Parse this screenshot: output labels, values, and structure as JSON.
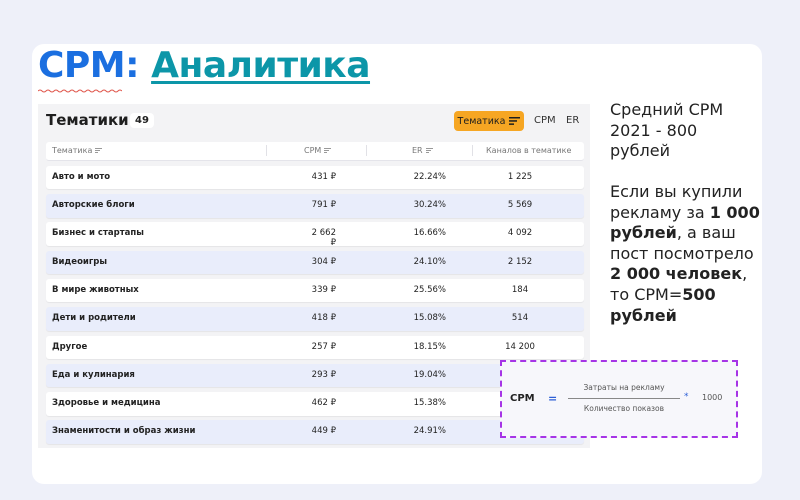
{
  "slide": {
    "title_part1": "CPM:",
    "title_part2": "Аналитика"
  },
  "screenshot": {
    "title": "Тематики",
    "count": "49",
    "filter_button": "Тематика",
    "tab_cpm": "CPM",
    "tab_er": "ER",
    "columns": [
      "Тематика",
      "CPM",
      "ER",
      "Каналов в тематике"
    ],
    "rows": [
      {
        "name": "Авто и мото",
        "cpm": "431 ₽",
        "er": "22.24%",
        "channels": "1 225"
      },
      {
        "name": "Авторские блоги",
        "cpm": "791 ₽",
        "er": "30.24%",
        "channels": "5 569"
      },
      {
        "name": "Бизнес и стартапы",
        "cpm": "2 662 ₽",
        "er": "16.66%",
        "channels": "4 092"
      },
      {
        "name": "Видеоигры",
        "cpm": "304 ₽",
        "er": "24.10%",
        "channels": "2 152"
      },
      {
        "name": "В мире животных",
        "cpm": "339 ₽",
        "er": "25.56%",
        "channels": "184"
      },
      {
        "name": "Дети и родители",
        "cpm": "418 ₽",
        "er": "15.08%",
        "channels": "514"
      },
      {
        "name": "Другое",
        "cpm": "257 ₽",
        "er": "18.15%",
        "channels": "14 200"
      },
      {
        "name": "Еда и кулинария",
        "cpm": "293 ₽",
        "er": "19.04%",
        "channels": ""
      },
      {
        "name": "Здоровье и медицина",
        "cpm": "462 ₽",
        "er": "15.38%",
        "channels": ""
      },
      {
        "name": "Знаменитости и образ жизни",
        "cpm": "449 ₽",
        "er": "24.91%",
        "channels": ""
      }
    ]
  },
  "side": {
    "avg_text": "Средний CPM\n2021 - 800\nрублей",
    "p_if": "Если вы купили рекламу за ",
    "p_amount": "1 000 рублей",
    "p_mid": ", а ваш пост посмотрело ",
    "p_views": "2 000 человек",
    "p_then": ", то CPM=",
    "p_result": "500 рублей"
  },
  "formula": {
    "lhs": "CPM",
    "eq": "=",
    "numerator": "Затраты на рекламу",
    "denominator": "Количество показов",
    "times": "*",
    "factor": "1000"
  },
  "colors": {
    "title_blue": "#1b6fe0",
    "title_teal": "#0c96a8",
    "filter_orange": "#f6a623",
    "row_alt": "#e9edfb",
    "formula_border": "#a634e6"
  }
}
